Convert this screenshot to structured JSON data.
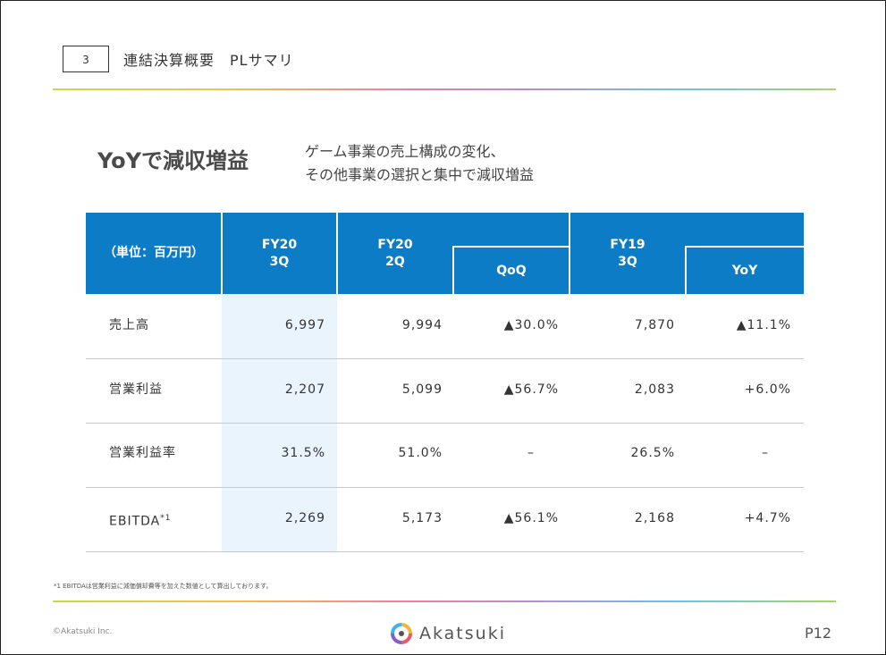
{
  "header": {
    "section_number": "3",
    "title": "連結決算概要　PLサマリ"
  },
  "headline": "YoYで減収増益",
  "subheading": {
    "line1": "ゲーム事業の売上構成の変化、",
    "line2": "その他事業の選択と集中で減収増益"
  },
  "table": {
    "unit_label": "（単位：百万円）",
    "col_fy20_3q": {
      "line1": "FY20",
      "line2": "3Q"
    },
    "col_fy20_2q": {
      "line1": "FY20",
      "line2": "2Q"
    },
    "col_qoq": "QoQ",
    "col_fy19_3q": {
      "line1": "FY19",
      "line2": "3Q"
    },
    "col_yoy": "YoY",
    "rows": [
      {
        "label": "売上高",
        "sup": "",
        "fy20_3q": "6,997",
        "fy20_2q": "9,994",
        "qoq": "▲30.0%",
        "fy19_3q": "7,870",
        "yoy": "▲11.1%"
      },
      {
        "label": "営業利益",
        "sup": "",
        "fy20_3q": "2,207",
        "fy20_2q": "5,099",
        "qoq": "▲56.7%",
        "fy19_3q": "2,083",
        "yoy": "+6.0%"
      },
      {
        "label": "営業利益率",
        "sup": "",
        "fy20_3q": "31.5%",
        "fy20_2q": "51.0%",
        "qoq": "–",
        "fy19_3q": "26.5%",
        "yoy": "–"
      },
      {
        "label": "EBITDA",
        "sup": "*1",
        "fy20_3q": "2,269",
        "fy20_2q": "5,173",
        "qoq": "▲56.1%",
        "fy19_3q": "2,168",
        "yoy": "+4.7%"
      }
    ]
  },
  "footnote": "*1 EBITDAは営業利益に減価償却費等を加えた数値として算出しております。",
  "footer": {
    "copyright": "©Akatsuki Inc.",
    "logo_text": "Akatsuki",
    "logo_icon": "akatsuki-ring-logo",
    "page_number": "P12"
  },
  "colors": {
    "header_blue": "#0d7cc6",
    "highlight_column": "#eaf4fc"
  }
}
